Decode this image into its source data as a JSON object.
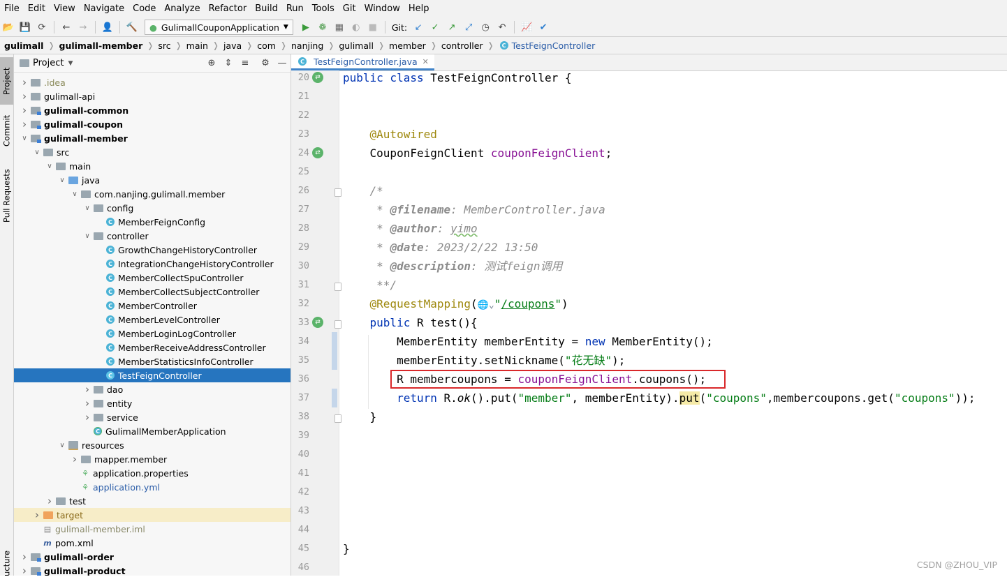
{
  "menu": [
    "File",
    "Edit",
    "View",
    "Navigate",
    "Code",
    "Analyze",
    "Refactor",
    "Build",
    "Run",
    "Tools",
    "Git",
    "Window",
    "Help"
  ],
  "toolbar": {
    "run_config": "GulimallCouponApplication",
    "git_label": "Git:"
  },
  "breadcrumbs": [
    "gulimall",
    "gulimall-member",
    "src",
    "main",
    "java",
    "com",
    "nanjing",
    "gulimall",
    "member",
    "controller",
    "TestFeignController"
  ],
  "side_tabs": [
    "Project",
    "Commit",
    "Pull Requests",
    "ucture"
  ],
  "project_panel": {
    "title": "Project"
  },
  "tree": [
    {
      "label": ".idea",
      "depth": 1,
      "arrow": ">",
      "icon": "folder",
      "style": "muted"
    },
    {
      "label": "gulimall-api",
      "depth": 1,
      "arrow": ">",
      "icon": "folder"
    },
    {
      "label": "gulimall-common",
      "depth": 1,
      "arrow": ">",
      "icon": "module",
      "style": "bold"
    },
    {
      "label": "gulimall-coupon",
      "depth": 1,
      "arrow": ">",
      "icon": "module",
      "style": "bold"
    },
    {
      "label": "gulimall-member",
      "depth": 1,
      "arrow": "v",
      "icon": "module",
      "style": "bold"
    },
    {
      "label": "src",
      "depth": 2,
      "arrow": "v",
      "icon": "folder"
    },
    {
      "label": "main",
      "depth": 3,
      "arrow": "v",
      "icon": "folder"
    },
    {
      "label": "java",
      "depth": 4,
      "arrow": "v",
      "icon": "folder-blue"
    },
    {
      "label": "com.nanjing.gulimall.member",
      "depth": 5,
      "arrow": "v",
      "icon": "folder"
    },
    {
      "label": "config",
      "depth": 6,
      "arrow": "v",
      "icon": "folder"
    },
    {
      "label": "MemberFeignConfig",
      "depth": 7,
      "arrow": "",
      "icon": "class"
    },
    {
      "label": "controller",
      "depth": 6,
      "arrow": "v",
      "icon": "folder"
    },
    {
      "label": "GrowthChangeHistoryController",
      "depth": 7,
      "arrow": "",
      "icon": "class"
    },
    {
      "label": "IntegrationChangeHistoryController",
      "depth": 7,
      "arrow": "",
      "icon": "class"
    },
    {
      "label": "MemberCollectSpuController",
      "depth": 7,
      "arrow": "",
      "icon": "class"
    },
    {
      "label": "MemberCollectSubjectController",
      "depth": 7,
      "arrow": "",
      "icon": "class"
    },
    {
      "label": "MemberController",
      "depth": 7,
      "arrow": "",
      "icon": "class"
    },
    {
      "label": "MemberLevelController",
      "depth": 7,
      "arrow": "",
      "icon": "class"
    },
    {
      "label": "MemberLoginLogController",
      "depth": 7,
      "arrow": "",
      "icon": "class"
    },
    {
      "label": "MemberReceiveAddressController",
      "depth": 7,
      "arrow": "",
      "icon": "class"
    },
    {
      "label": "MemberStatisticsInfoController",
      "depth": 7,
      "arrow": "",
      "icon": "class"
    },
    {
      "label": "TestFeignController",
      "depth": 7,
      "arrow": "",
      "icon": "class",
      "style": "selected"
    },
    {
      "label": "dao",
      "depth": 6,
      "arrow": ">",
      "icon": "folder"
    },
    {
      "label": "entity",
      "depth": 6,
      "arrow": ">",
      "icon": "folder"
    },
    {
      "label": "service",
      "depth": 6,
      "arrow": ">",
      "icon": "folder"
    },
    {
      "label": "GulimallMemberApplication",
      "depth": 6,
      "arrow": "",
      "icon": "spring-class"
    },
    {
      "label": "resources",
      "depth": 4,
      "arrow": "v",
      "icon": "folder-res"
    },
    {
      "label": "mapper.member",
      "depth": 5,
      "arrow": ">",
      "icon": "folder"
    },
    {
      "label": "application.properties",
      "depth": 5,
      "arrow": "",
      "icon": "spring-file"
    },
    {
      "label": "application.yml",
      "depth": 5,
      "arrow": "",
      "icon": "spring-file",
      "style": "blue"
    },
    {
      "label": "test",
      "depth": 3,
      "arrow": ">",
      "icon": "folder"
    },
    {
      "label": "target",
      "depth": 2,
      "arrow": ">",
      "icon": "folder-orange",
      "style": "target"
    },
    {
      "label": "gulimall-member.iml",
      "depth": 2,
      "arrow": "",
      "icon": "iml",
      "style": "muted"
    },
    {
      "label": "pom.xml",
      "depth": 2,
      "arrow": "",
      "icon": "maven"
    },
    {
      "label": "gulimall-order",
      "depth": 1,
      "arrow": ">",
      "icon": "module",
      "style": "bold"
    },
    {
      "label": "gulimall-product",
      "depth": 1,
      "arrow": ">",
      "icon": "module",
      "style": "bold"
    }
  ],
  "editor": {
    "tab_label": "TestFeignController.java",
    "line_numbers": [
      "20",
      "21",
      "22",
      "23",
      "24",
      "25",
      "26",
      "27",
      "28",
      "29",
      "30",
      "31",
      "32",
      "33",
      "34",
      "35",
      "36",
      "37",
      "38",
      "39",
      "40",
      "41",
      "42",
      "43",
      "44",
      "45",
      "46"
    ],
    "code": {
      "l20_a": "public class",
      "l20_b": " TestFeignController {",
      "l23": "@Autowired",
      "l24_a": "CouponFeignClient ",
      "l24_b": "couponFeignClient",
      "l24_c": ";",
      "l26": "/*",
      "l27_a": " * ",
      "l27_b": "@filename",
      "l27_c": ": MemberController.java",
      "l28_a": " * ",
      "l28_b": "@author",
      "l28_c": ": ",
      "l28_d": "yimo",
      "l29_a": " * ",
      "l29_b": "@date",
      "l29_c": ": 2023/2/22 13:50",
      "l30_a": " * ",
      "l30_b": "@description",
      "l30_c": ": 测试feign调用",
      "l31": " **/",
      "l32_a": "@RequestMapping",
      "l32_b": "(",
      "l32_c": "\"",
      "l32_d": "/coupons",
      "l32_e": "\"",
      "l32_f": ")",
      "l33_a": "public",
      "l33_b": " R test(){",
      "l34_a": "MemberEntity memberEntity = ",
      "l34_b": "new",
      "l34_c": " MemberEntity();",
      "l35_a": "memberEntity.setNickname(",
      "l35_b": "\"花无缺\"",
      "l35_c": ");",
      "l36_a": "R membercoupons = ",
      "l36_b": "couponFeignClient",
      "l36_c": ".coupons();",
      "l37_a": "return",
      "l37_b": " R.",
      "l37_c": "ok",
      "l37_d": "().put(",
      "l37_e": "\"member\"",
      "l37_f": ", memberEntity).",
      "l37_g": "put",
      "l37_h": "(",
      "l37_i": "\"coupons\"",
      "l37_j": ",membercoupons.get(",
      "l37_k": "\"coupons\"",
      "l37_l": "));",
      "l38": "}",
      "l45": "}"
    }
  },
  "watermark": "CSDN @ZHOU_VIP",
  "colors": {
    "selection": "#2675bf",
    "keyword": "#0033b3",
    "annotation": "#9e880d",
    "string": "#067d17",
    "field": "#871094",
    "highlight_box": "#d9282a"
  }
}
